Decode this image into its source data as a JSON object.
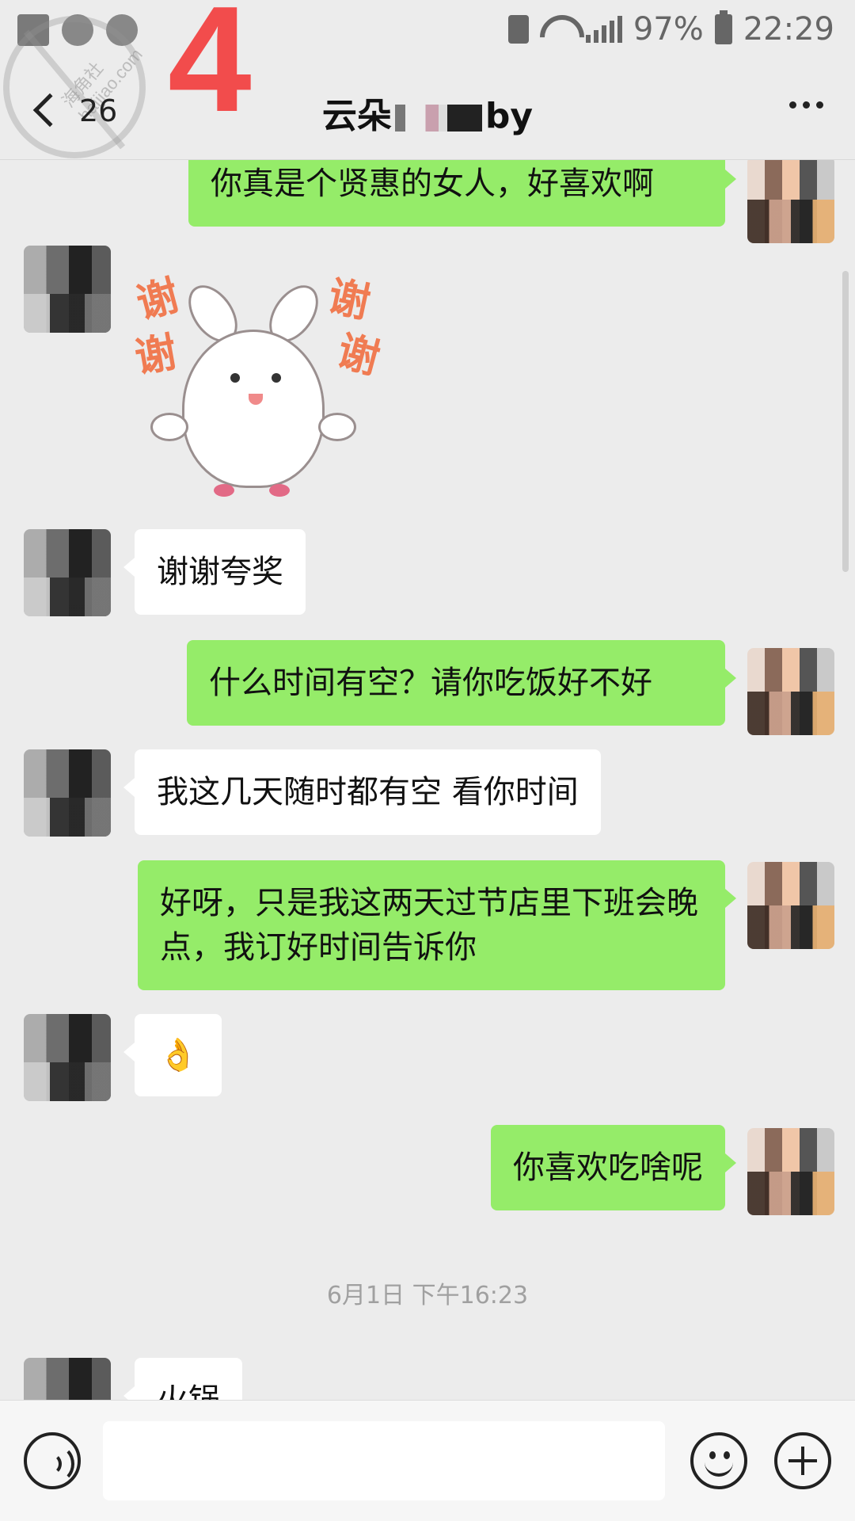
{
  "status_bar": {
    "battery": "97%",
    "time": "22:29"
  },
  "overlay": {
    "number": "4",
    "watermark_text": "海角社 haijiao.com"
  },
  "header": {
    "back_count": "26",
    "title_start": "云朵",
    "title_end": "by"
  },
  "messages": [
    {
      "side": "right",
      "type": "text",
      "text": "你真是个贤惠的女人，好喜欢啊"
    },
    {
      "side": "left",
      "type": "sticker",
      "sticker_text": [
        "谢",
        "谢",
        "谢",
        "谢"
      ]
    },
    {
      "side": "left",
      "type": "text",
      "text": "谢谢夸奖"
    },
    {
      "side": "right",
      "type": "text",
      "text": "什么时间有空？请你吃饭好不好"
    },
    {
      "side": "left",
      "type": "text",
      "text": "我这几天随时都有空 看你时间"
    },
    {
      "side": "right",
      "type": "text",
      "text": "好呀，只是我这两天过节店里下班会晚点，我订好时间告诉你"
    },
    {
      "side": "left",
      "type": "emoji",
      "text": "👌"
    },
    {
      "side": "right",
      "type": "text",
      "text": "你喜欢吃啥呢"
    },
    {
      "side": "left",
      "type": "text",
      "text": "火锅"
    }
  ],
  "timestamp": "6月1日 下午16:23",
  "input_bar": {
    "voice_icon": "voice-icon",
    "emoji_icon": "emoji-icon",
    "plus_icon": "plus-icon"
  }
}
